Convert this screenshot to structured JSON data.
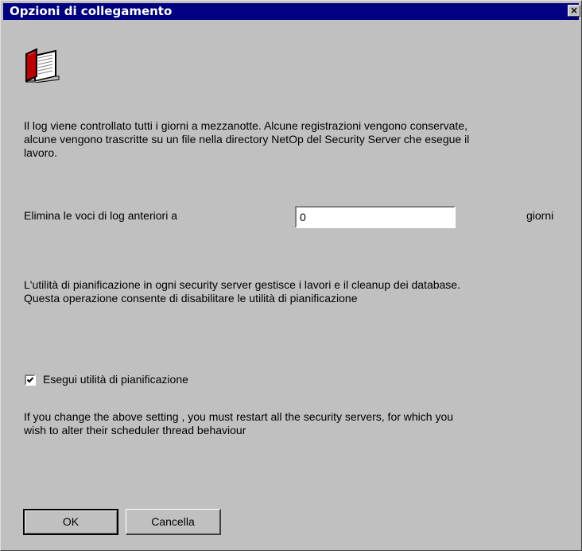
{
  "window": {
    "title": "Opzioni di collegamento",
    "close_glyph": "×",
    "titlebar_color": "#000080",
    "face_color": "#c0c0c0"
  },
  "icons": {
    "header_icon": "book-icon",
    "close_icon": "close-icon",
    "check_icon": "checkmark-icon"
  },
  "intro": {
    "text": "Il log viene controllato tutti i giorni a mezzanotte. Alcune registrazioni vengono conservate,\nalcune vengono trascritte su un file nella directory NetOp del Security Server che esegue il\nlavoro."
  },
  "delete_log": {
    "label": "Elimina le voci di log anteriori a",
    "value": "0",
    "unit": "giorni"
  },
  "scheduler": {
    "text": "L'utilità di pianificazione in ogni security server gestisce i lavori e il cleanup dei database.\nQuesta operazione consente di disabilitare le utilità di pianificazione",
    "checkbox_label": "Esegui utilità di pianificazione",
    "checked": true
  },
  "restart_note": {
    "text": "If you change the above setting , you must restart all the security servers, for which you\nwish  to alter their scheduler thread behaviour"
  },
  "buttons": {
    "ok": "OK",
    "cancel": "Cancella"
  }
}
